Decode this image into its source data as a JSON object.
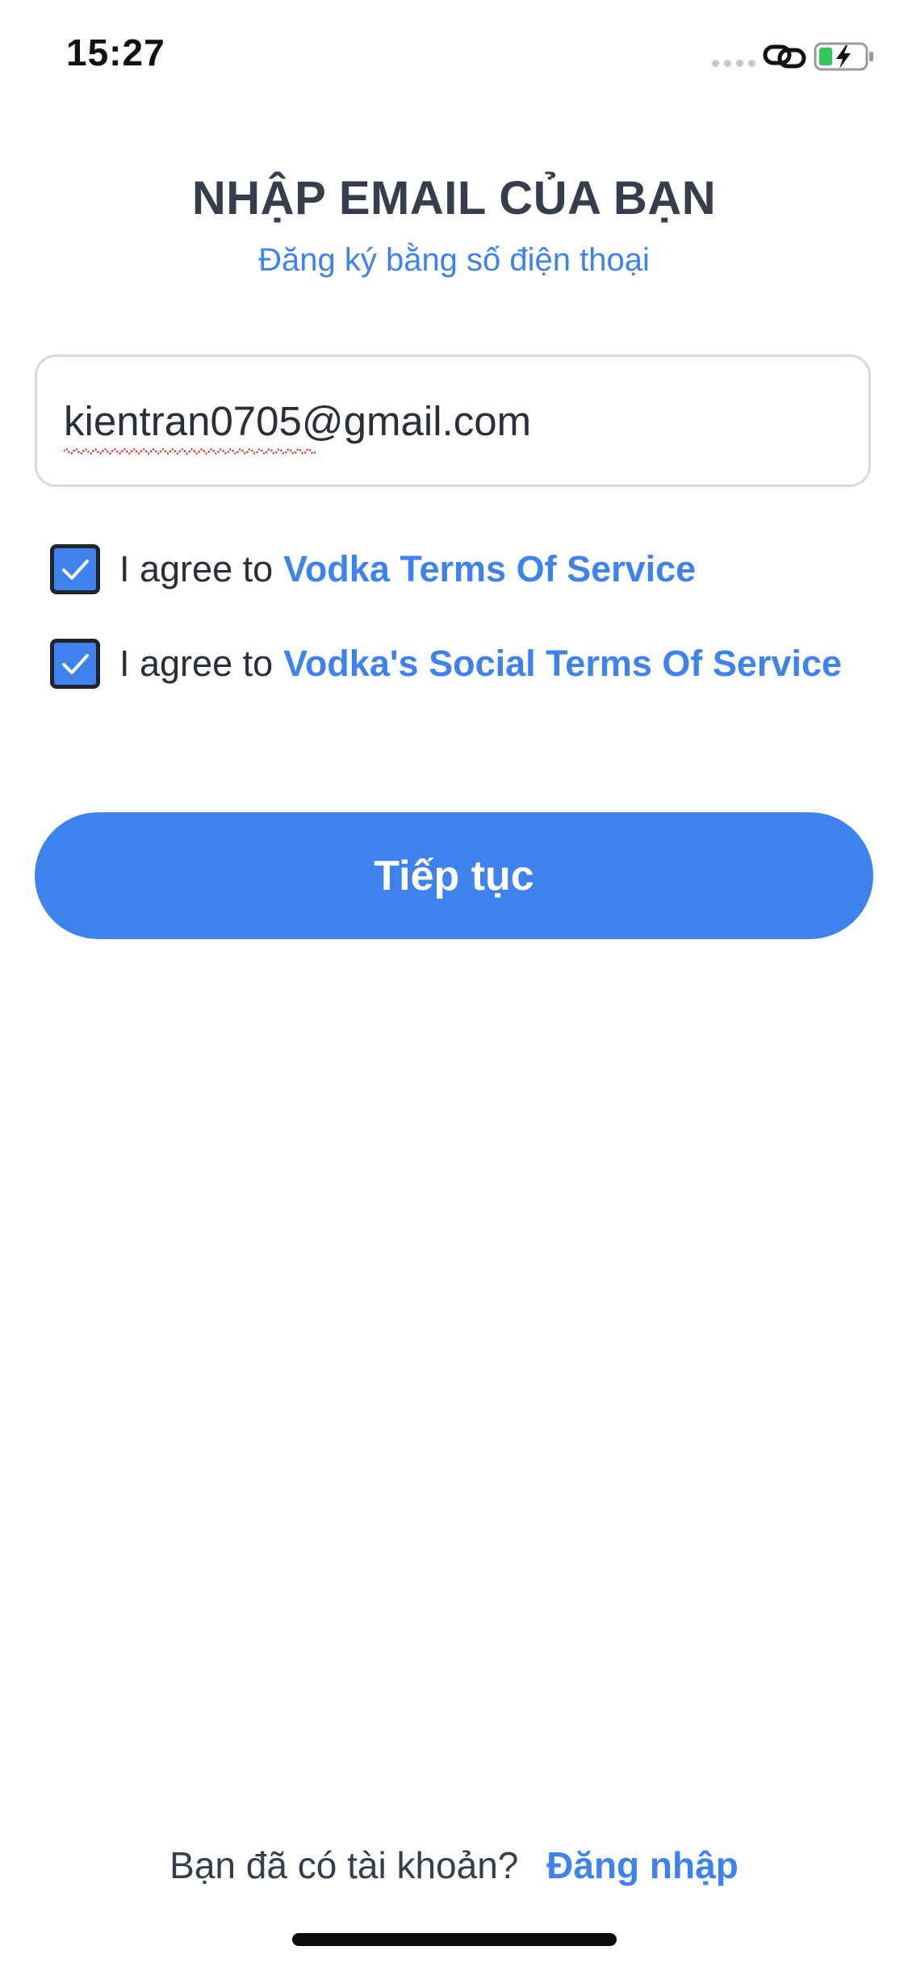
{
  "status_bar": {
    "time": "15:27",
    "icons": [
      "signal-dots-icon",
      "link-icon",
      "battery-charging-icon"
    ]
  },
  "header": {
    "title": "NHẬP EMAIL CỦA BẠN",
    "phone_signup_link": "Đăng ký bằng số điện thoại"
  },
  "email_input": {
    "value": "kientran0705@gmail.com"
  },
  "agreements": [
    {
      "checked": true,
      "prefix": "I agree to",
      "link_text": "Vodka Terms Of Service"
    },
    {
      "checked": true,
      "prefix": "I agree to",
      "link_text": "Vodka's Social Terms Of Service"
    }
  ],
  "continue_button": {
    "label": "Tiếp tục"
  },
  "footer": {
    "question": "Bạn đã có tài khoản?",
    "login_link": "Đăng nhập"
  },
  "colors": {
    "accent": "#3e82ee",
    "title": "#363d4c",
    "border": "#d9d9dd",
    "battery_charge": "#34c759"
  }
}
